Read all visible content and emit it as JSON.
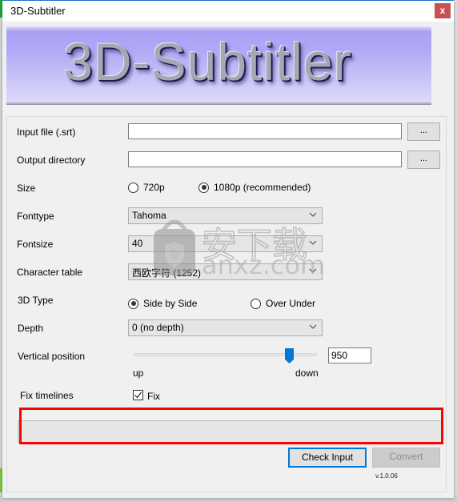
{
  "window": {
    "title": "3D-Subtitler",
    "close_icon": "close-icon",
    "close_glyph": "x"
  },
  "banner": {
    "text": "3D-Subtitler"
  },
  "form": {
    "input_file": {
      "label": "Input file (.srt)",
      "value": "",
      "browse_label": "..."
    },
    "output_directory": {
      "label": "Output directory",
      "value": "",
      "browse_label": "..."
    },
    "size": {
      "label": "Size",
      "options": [
        {
          "label": "720p",
          "checked": false
        },
        {
          "label": "1080p (recommended)",
          "checked": true
        }
      ]
    },
    "fonttype": {
      "label": "Fonttype",
      "selected": "Tahoma"
    },
    "fontsize": {
      "label": "Fontsize",
      "selected": "40"
    },
    "character_table": {
      "label": "Character table",
      "selected": "西欧字符 (1252)"
    },
    "type_3d": {
      "label": "3D Type",
      "options": [
        {
          "label": "Side by Side",
          "checked": true
        },
        {
          "label": "Over Under",
          "checked": false
        }
      ]
    },
    "depth": {
      "label": "Depth",
      "selected": "0 (no depth)"
    },
    "vertical_position": {
      "label": "Vertical position",
      "min_label": "up",
      "max_label": "down",
      "slider_fraction": 0.85,
      "value": "950"
    },
    "fix_timelines": {
      "label": "Fix timelines",
      "checkbox_label": "Fix",
      "checked": true
    }
  },
  "progress": {
    "value": 0
  },
  "buttons": {
    "check_input": "Check Input",
    "convert": "Convert"
  },
  "version": "v.1.0.06",
  "watermark": {
    "cn_text": "安下载",
    "domain": "anxz.com"
  },
  "colors": {
    "accent": "#0078d7",
    "close": "#c75050",
    "highlight": "#ff0000"
  }
}
